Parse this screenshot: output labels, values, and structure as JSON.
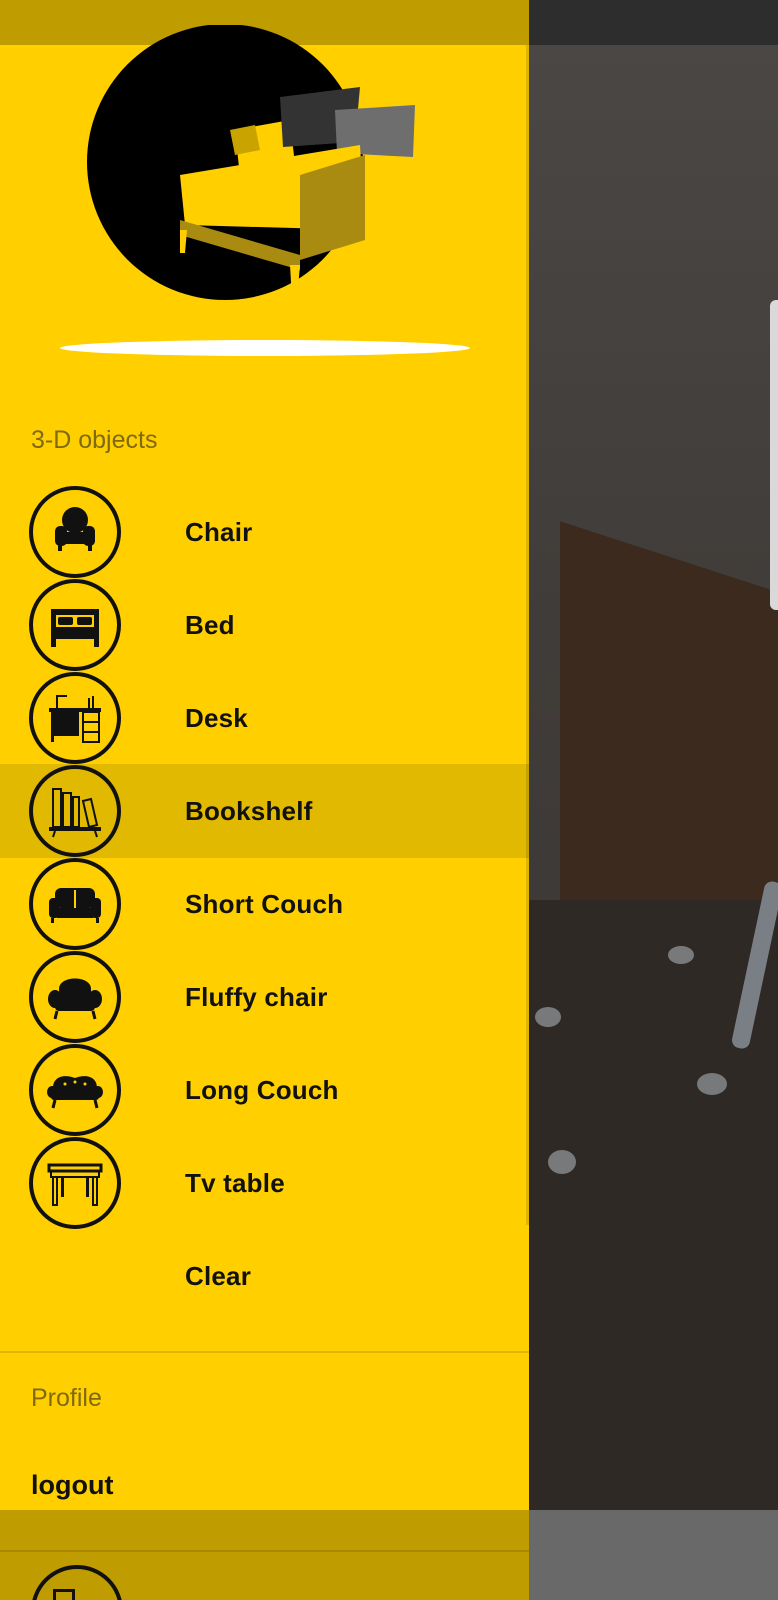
{
  "drawer": {
    "logo_icon": "armchair-logo",
    "section_objects": "3-D objects",
    "items": [
      {
        "label": "Chair",
        "icon": "armchair-icon"
      },
      {
        "label": "Bed",
        "icon": "bed-icon"
      },
      {
        "label": "Desk",
        "icon": "desk-icon"
      },
      {
        "label": "Bookshelf",
        "icon": "bookshelf-icon",
        "selected": true
      },
      {
        "label": "Short Couch",
        "icon": "short-couch-icon"
      },
      {
        "label": "Fluffy chair",
        "icon": "fluffy-chair-icon"
      },
      {
        "label": "Long Couch",
        "icon": "long-couch-icon"
      },
      {
        "label": "Tv table",
        "icon": "tv-table-icon"
      }
    ],
    "clear_label": "Clear",
    "section_profile": "Profile",
    "logout_label": "logout"
  },
  "colors": {
    "drawer_bg": "#FFCF00",
    "selected_bg": "#E0B900",
    "status_band": "#BF9C00",
    "section_label": "#7f6a12"
  }
}
